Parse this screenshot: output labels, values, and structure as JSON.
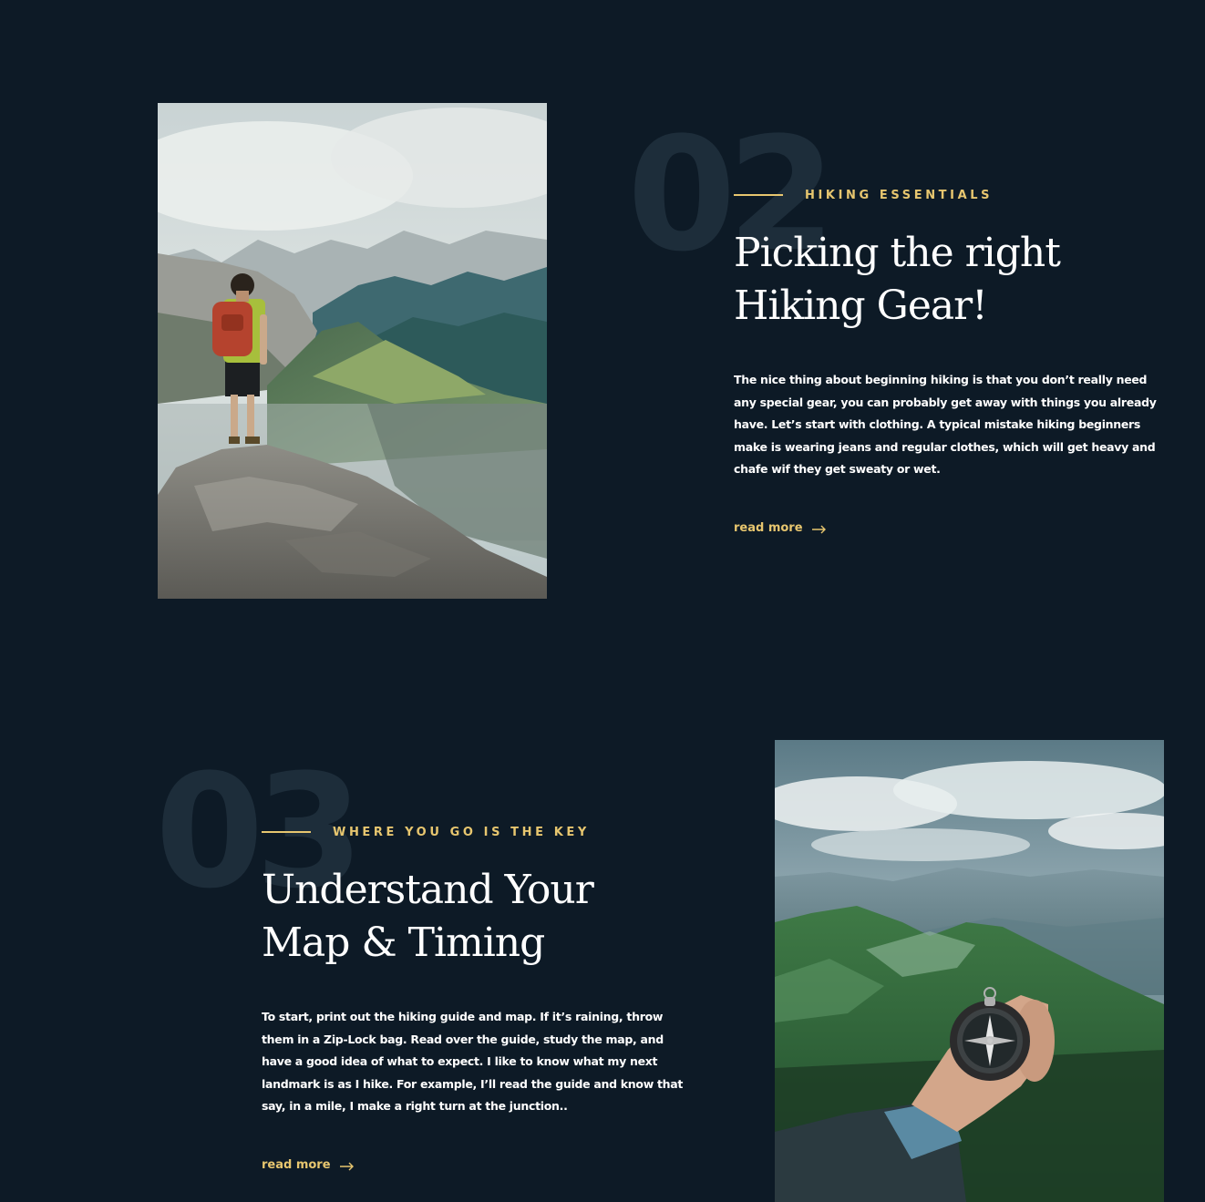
{
  "articles": [
    {
      "number": "02",
      "eyebrow": "Hiking Essentials",
      "title_line1": "Picking the right",
      "title_line2": "Hiking Gear!",
      "body": "The nice thing about beginning hiking is that you don’t really need any special gear, you can probably get away with things you already have. Let’s start with clothing. A typical mistake hiking beginners make is wearing jeans and regular clothes, which will get heavy and chafe wif they get sweaty or wet.",
      "read_more": "read more",
      "image": "hiker-on-mountain-ridge-photo"
    },
    {
      "number": "03",
      "eyebrow": "Where you go is the key",
      "title_line1": "Understand Your",
      "title_line2": "Map & Timing",
      "body": "To start, print out the hiking guide and map. If it’s raining, throw them in a Zip-Lock bag. Read over the guide, study the map, and have a good idea of what to expect. I like to know what my next landmark is as I hike. For example, I’ll read the guide and know that say, in a mile, I make a right turn at the junction..",
      "read_more": "read more",
      "image": "hand-holding-compass-photo"
    }
  ],
  "colors": {
    "background": "#0d1a26",
    "accent": "#e7c66f",
    "number_watermark": "#1f2f3c",
    "text": "#ffffff"
  }
}
